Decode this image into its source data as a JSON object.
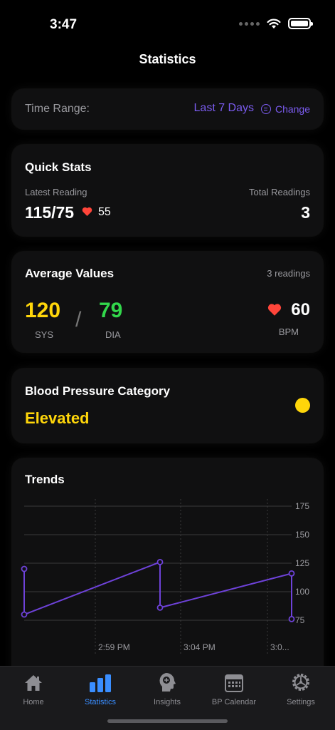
{
  "status_bar": {
    "time": "3:47"
  },
  "nav": {
    "title": "Statistics"
  },
  "time_range": {
    "label": "Time Range:",
    "value": "Last 7 Days",
    "change_label": "Change"
  },
  "quick_stats": {
    "title": "Quick Stats",
    "latest_label": "Latest Reading",
    "latest_value": "115/75",
    "latest_pulse": "55",
    "total_label": "Total Readings",
    "total_value": "3"
  },
  "average_values": {
    "title": "Average Values",
    "count_text": "3 readings",
    "sys_value": "120",
    "sys_label": "SYS",
    "separator": "/",
    "dia_value": "79",
    "dia_label": "DIA",
    "bpm_value": "60",
    "bpm_label": "BPM"
  },
  "category": {
    "title": "Blood Pressure Category",
    "value": "Elevated",
    "color": "#ffd60a"
  },
  "trends": {
    "title": "Trends"
  },
  "chart_data": {
    "type": "line",
    "ylim": [
      75,
      175
    ],
    "y_ticks": [
      "175",
      "150",
      "125",
      "100",
      "75"
    ],
    "x_ticks": [
      "2:59 PM",
      "3:04 PM",
      "3:0..."
    ],
    "grid": true,
    "series": [
      {
        "values": [
          [
            0,
            120
          ],
          [
            0,
            80
          ],
          [
            1,
            126
          ],
          [
            1,
            86
          ],
          [
            2,
            116
          ],
          [
            2,
            76
          ]
        ]
      }
    ],
    "colors": {
      "line": "#6e42d9",
      "grid": "#3a3a3c"
    }
  },
  "tabs": [
    {
      "label": "Home",
      "icon": "home-icon",
      "active": false
    },
    {
      "label": "Statistics",
      "icon": "chart-bar-icon",
      "active": true
    },
    {
      "label": "Insights",
      "icon": "brain-head-icon",
      "active": false
    },
    {
      "label": "BP Calendar",
      "icon": "calendar-icon",
      "active": false
    },
    {
      "label": "Settings",
      "icon": "gear-icon",
      "active": false
    }
  ],
  "colors": {
    "accent": "#7b5cf0",
    "tab_active": "#3a8eff",
    "sys": "#ffd60a",
    "dia": "#32d74b",
    "heart": "#ff453a"
  }
}
